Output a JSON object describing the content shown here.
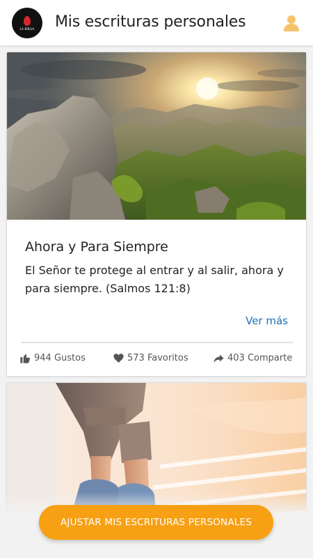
{
  "app": {
    "title": "Mis escrituras personales",
    "logo_text": "LA BIBLIA",
    "user_icon": "user-icon"
  },
  "cards": [
    {
      "title": "Ahora y Para Siempre",
      "text": "El Señor te protege al entrar y al salir, ahora y para siempre. (Salmos 121:8)",
      "see_more": "Ver más",
      "likes": "944 Gustos",
      "favorites": "573 Favoritos",
      "shares": "403 Comparte",
      "image": "mountain-sunrise-landscape"
    },
    {
      "image": "person-walking-up-stairs"
    }
  ],
  "cta": {
    "label": "AJUSTAR MIS ESCRITURAS PERSONALES"
  },
  "colors": {
    "accent": "#f7a013",
    "link": "#1e6fb4",
    "user_icon": "#f6c36b"
  }
}
